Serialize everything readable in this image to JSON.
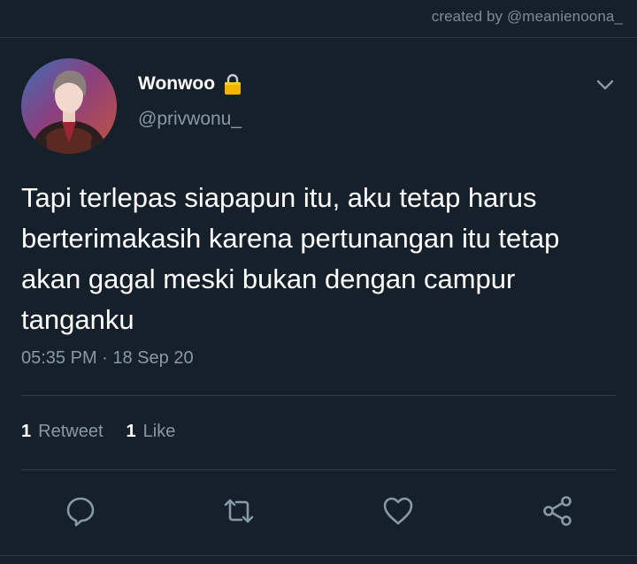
{
  "watermark": "created by @meanienoona_",
  "tweet": {
    "display_name": "Wonwoo",
    "handle": "@privwonu_",
    "text": "Tapi terlepas siapapun itu, aku tetap harus berterimakasih karena pertunangan itu tetap akan gagal meski bukan dengan campur tanganku",
    "timestamp": "05:35 PM · 18 Sep 20"
  },
  "stats": {
    "retweet_count": "1",
    "retweet_label": "Retweet",
    "like_count": "1",
    "like_label": "Like"
  },
  "icons": {
    "protected": "lock-icon",
    "menu": "chevron-down-icon",
    "reply": "reply-icon",
    "retweet": "retweet-icon",
    "like": "heart-icon",
    "share": "share-icon"
  },
  "colors": {
    "background": "#15202b",
    "secondary_text": "#8899a6",
    "primary_text": "#ffffff",
    "lock": "#f5b400"
  }
}
